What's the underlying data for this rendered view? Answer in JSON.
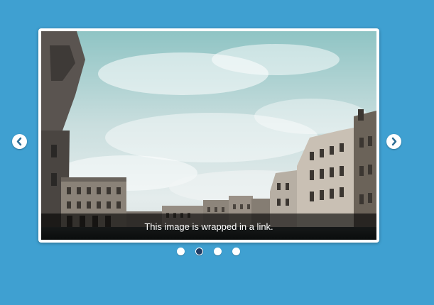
{
  "slider": {
    "caption": "This image is wrapped in a link.",
    "prev_icon": "chevron-left-icon",
    "next_icon": "chevron-right-icon",
    "slide_count": 4,
    "active_slide": 2
  },
  "colors": {
    "background": "#3fa0d1",
    "frame": "#ffffff",
    "active_dot": "#203c64",
    "inactive_dot": "#ffffff"
  }
}
